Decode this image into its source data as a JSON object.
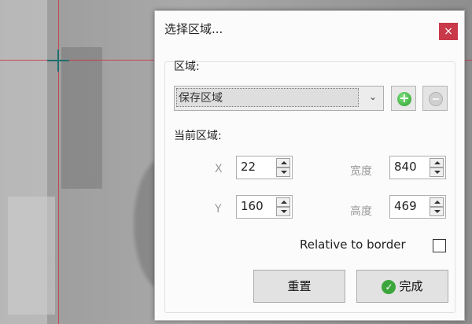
{
  "dialog": {
    "title": "选择区域...",
    "close_label": "×"
  },
  "region_section": {
    "label": "区域:",
    "selected_option": "保存区域"
  },
  "current_region": {
    "label": "当前区域:",
    "x_label": "X",
    "x_value": "22",
    "y_label": "Y",
    "y_value": "160",
    "width_label": "宽度",
    "width_value": "840",
    "height_label": "高度",
    "height_value": "469"
  },
  "relative_border": {
    "label": "Relative to border",
    "checked": false
  },
  "buttons": {
    "reset_label": "重置",
    "done_label": "完成"
  },
  "colors": {
    "close_bg": "#c9394a",
    "crosshair": "#cc3344",
    "add_green": "#2da02d"
  }
}
